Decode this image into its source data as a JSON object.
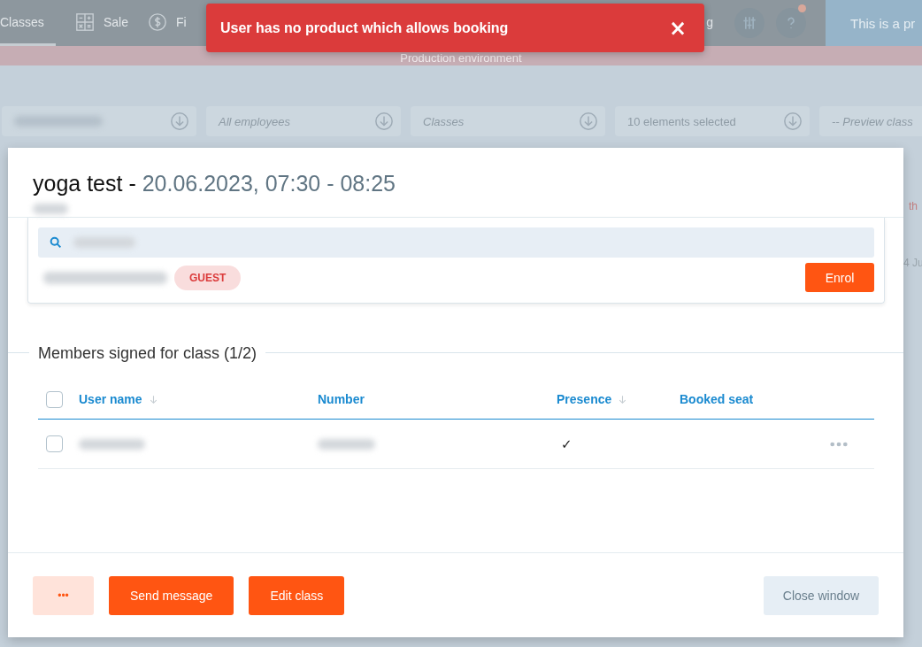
{
  "nav": {
    "tabs": [
      {
        "label": "Classes",
        "selected": true
      },
      {
        "label": "Sale",
        "selected": false
      },
      {
        "label": "Fi",
        "selected": false
      },
      {
        "label": "g",
        "selected": false
      }
    ],
    "banner": "This is a pr"
  },
  "environment_bar": "Production environment",
  "filters": [
    {
      "kind": "blurred"
    },
    {
      "kind": "placeholder",
      "placeholder": "All employees"
    },
    {
      "kind": "placeholder",
      "placeholder": "Classes"
    },
    {
      "kind": "value",
      "value": "10 elements selected"
    },
    {
      "kind": "placeholder",
      "placeholder": "-- Preview class"
    }
  ],
  "background_fragments": [
    "th",
    "4 Ju"
  ],
  "toast": {
    "message": "User has no product which allows booking",
    "close": "×"
  },
  "modal": {
    "title": "yoga test - ",
    "datetime": "20.06.2023, 07:30 - 08:25",
    "search_result": {
      "badge": "GUEST",
      "button": "Enrol"
    },
    "section_title": "Members signed for class (1/2)",
    "table": {
      "select_all": {
        "checked": false
      },
      "columns": [
        {
          "label": "User name",
          "sortable": true
        },
        {
          "label": "Number",
          "sortable": false
        },
        {
          "label": "Presence",
          "sortable": true
        },
        {
          "label": "Booked seat",
          "sortable": false
        }
      ],
      "rows": [
        {
          "checked": false,
          "presence": "✓"
        }
      ]
    },
    "footer": {
      "buttons": [
        {
          "label": "•••",
          "kind": "light"
        },
        {
          "label": "Send message",
          "kind": "primary"
        },
        {
          "label": "Edit class",
          "kind": "primary"
        },
        {
          "label": "Close window",
          "kind": "secondary"
        }
      ]
    }
  }
}
